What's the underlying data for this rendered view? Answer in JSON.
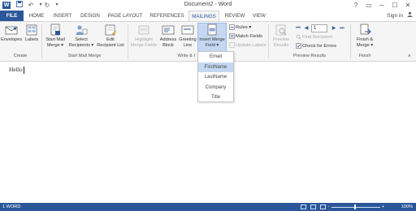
{
  "window": {
    "title": "Document2 - Word",
    "controls": {
      "help": "?",
      "restore": "▭",
      "minimize": "─",
      "maximize": "☐",
      "close": "✕"
    }
  },
  "quick_access": {
    "app_letter": "W",
    "save": "💾",
    "undo": "↶",
    "redo": "↻"
  },
  "tabs": [
    {
      "label": "FILE"
    },
    {
      "label": "HOME"
    },
    {
      "label": "INSERT"
    },
    {
      "label": "DESIGN"
    },
    {
      "label": "PAGE LAYOUT"
    },
    {
      "label": "REFERENCES"
    },
    {
      "label": "MAILINGS"
    },
    {
      "label": "REVIEW"
    },
    {
      "label": "VIEW"
    }
  ],
  "account": {
    "sign_in": "Sign in"
  },
  "ribbon": {
    "create": {
      "label": "Create",
      "envelopes": "Envelopes",
      "labels": "Labels"
    },
    "start": {
      "label": "Start Mail Merge",
      "start_line1": "Start Mail",
      "start_line2": "Merge ▾",
      "select_line1": "Select",
      "select_line2": "Recipients ▾",
      "edit_line1": "Edit",
      "edit_line2": "Recipient List"
    },
    "write": {
      "label": "Write & I",
      "highlight_line1": "Highlight",
      "highlight_line2": "Merge Fields",
      "address_line1": "Address",
      "address_line2": "Block",
      "greeting_line1": "Greeting",
      "greeting_line2": "Line",
      "insert_line1": "Insert Merge",
      "insert_line2": "Field ▾",
      "rules": "Rules ▾",
      "match": "Match Fields",
      "update": "Update Labels"
    },
    "preview": {
      "label": "Preview Results",
      "preview_line1": "Preview",
      "preview_line2": "Results",
      "record": "1",
      "find": "Find Recipient",
      "check": "Check for Errors"
    },
    "finish": {
      "label": "Finish",
      "finish_line1": "Finish &",
      "finish_line2": "Merge ▾"
    }
  },
  "merge_field_menu": {
    "items": [
      "Email",
      "FirstName",
      "LastName",
      "Company",
      "Title"
    ],
    "highlighted": "FirstName"
  },
  "document": {
    "text": "Hello"
  },
  "status_bar": {
    "words": "1 WORD",
    "zoom": "100%",
    "zoom_minus": "-",
    "zoom_plus": "+"
  },
  "colors": {
    "accent": "#2b579a",
    "highlight": "#c5d8f1"
  }
}
